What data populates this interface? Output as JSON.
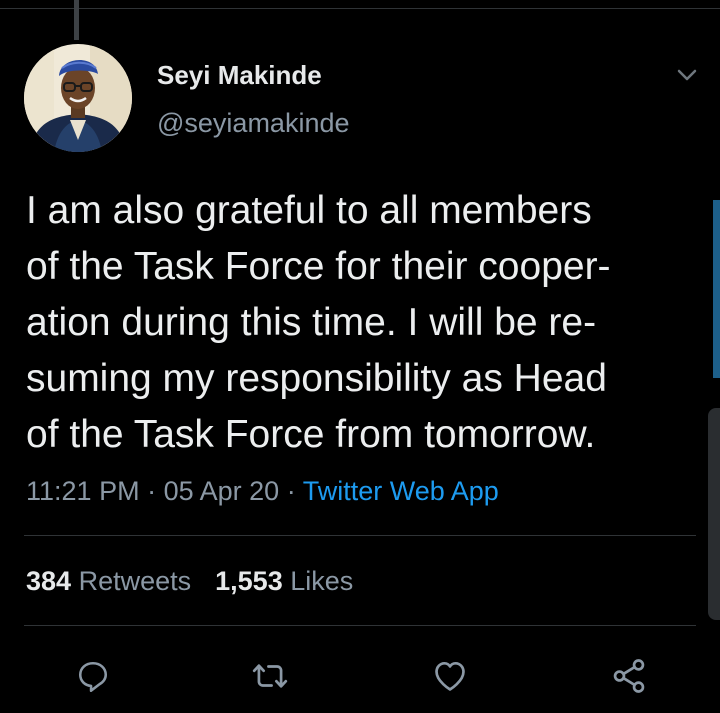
{
  "tweet": {
    "author": {
      "display_name": "Seyi Makinde",
      "handle": "@seyiamakinde"
    },
    "text_lines": [
      "I am also grateful to all members",
      "of the Task Force for their cooper-",
      "ation during this time. I will be re-",
      "suming my responsibility as Head",
      "of the Task Force from tomorrow."
    ],
    "time": "11:21 PM",
    "separator": "·",
    "date": "05 Apr 20",
    "source": "Twitter Web App",
    "retweets_count": "384",
    "retweets_label": "Retweets",
    "likes_count": "1,553",
    "likes_label": "Likes"
  },
  "icons": {
    "more": "chevron-down-icon",
    "reply": "reply-icon",
    "retweet": "retweet-icon",
    "like": "heart-icon",
    "share": "share-icon"
  },
  "colors": {
    "background": "#000000",
    "text": "#e7e9ea",
    "secondary_text": "#8b98a5",
    "link": "#1d9bf0",
    "divider": "#2f3336"
  }
}
